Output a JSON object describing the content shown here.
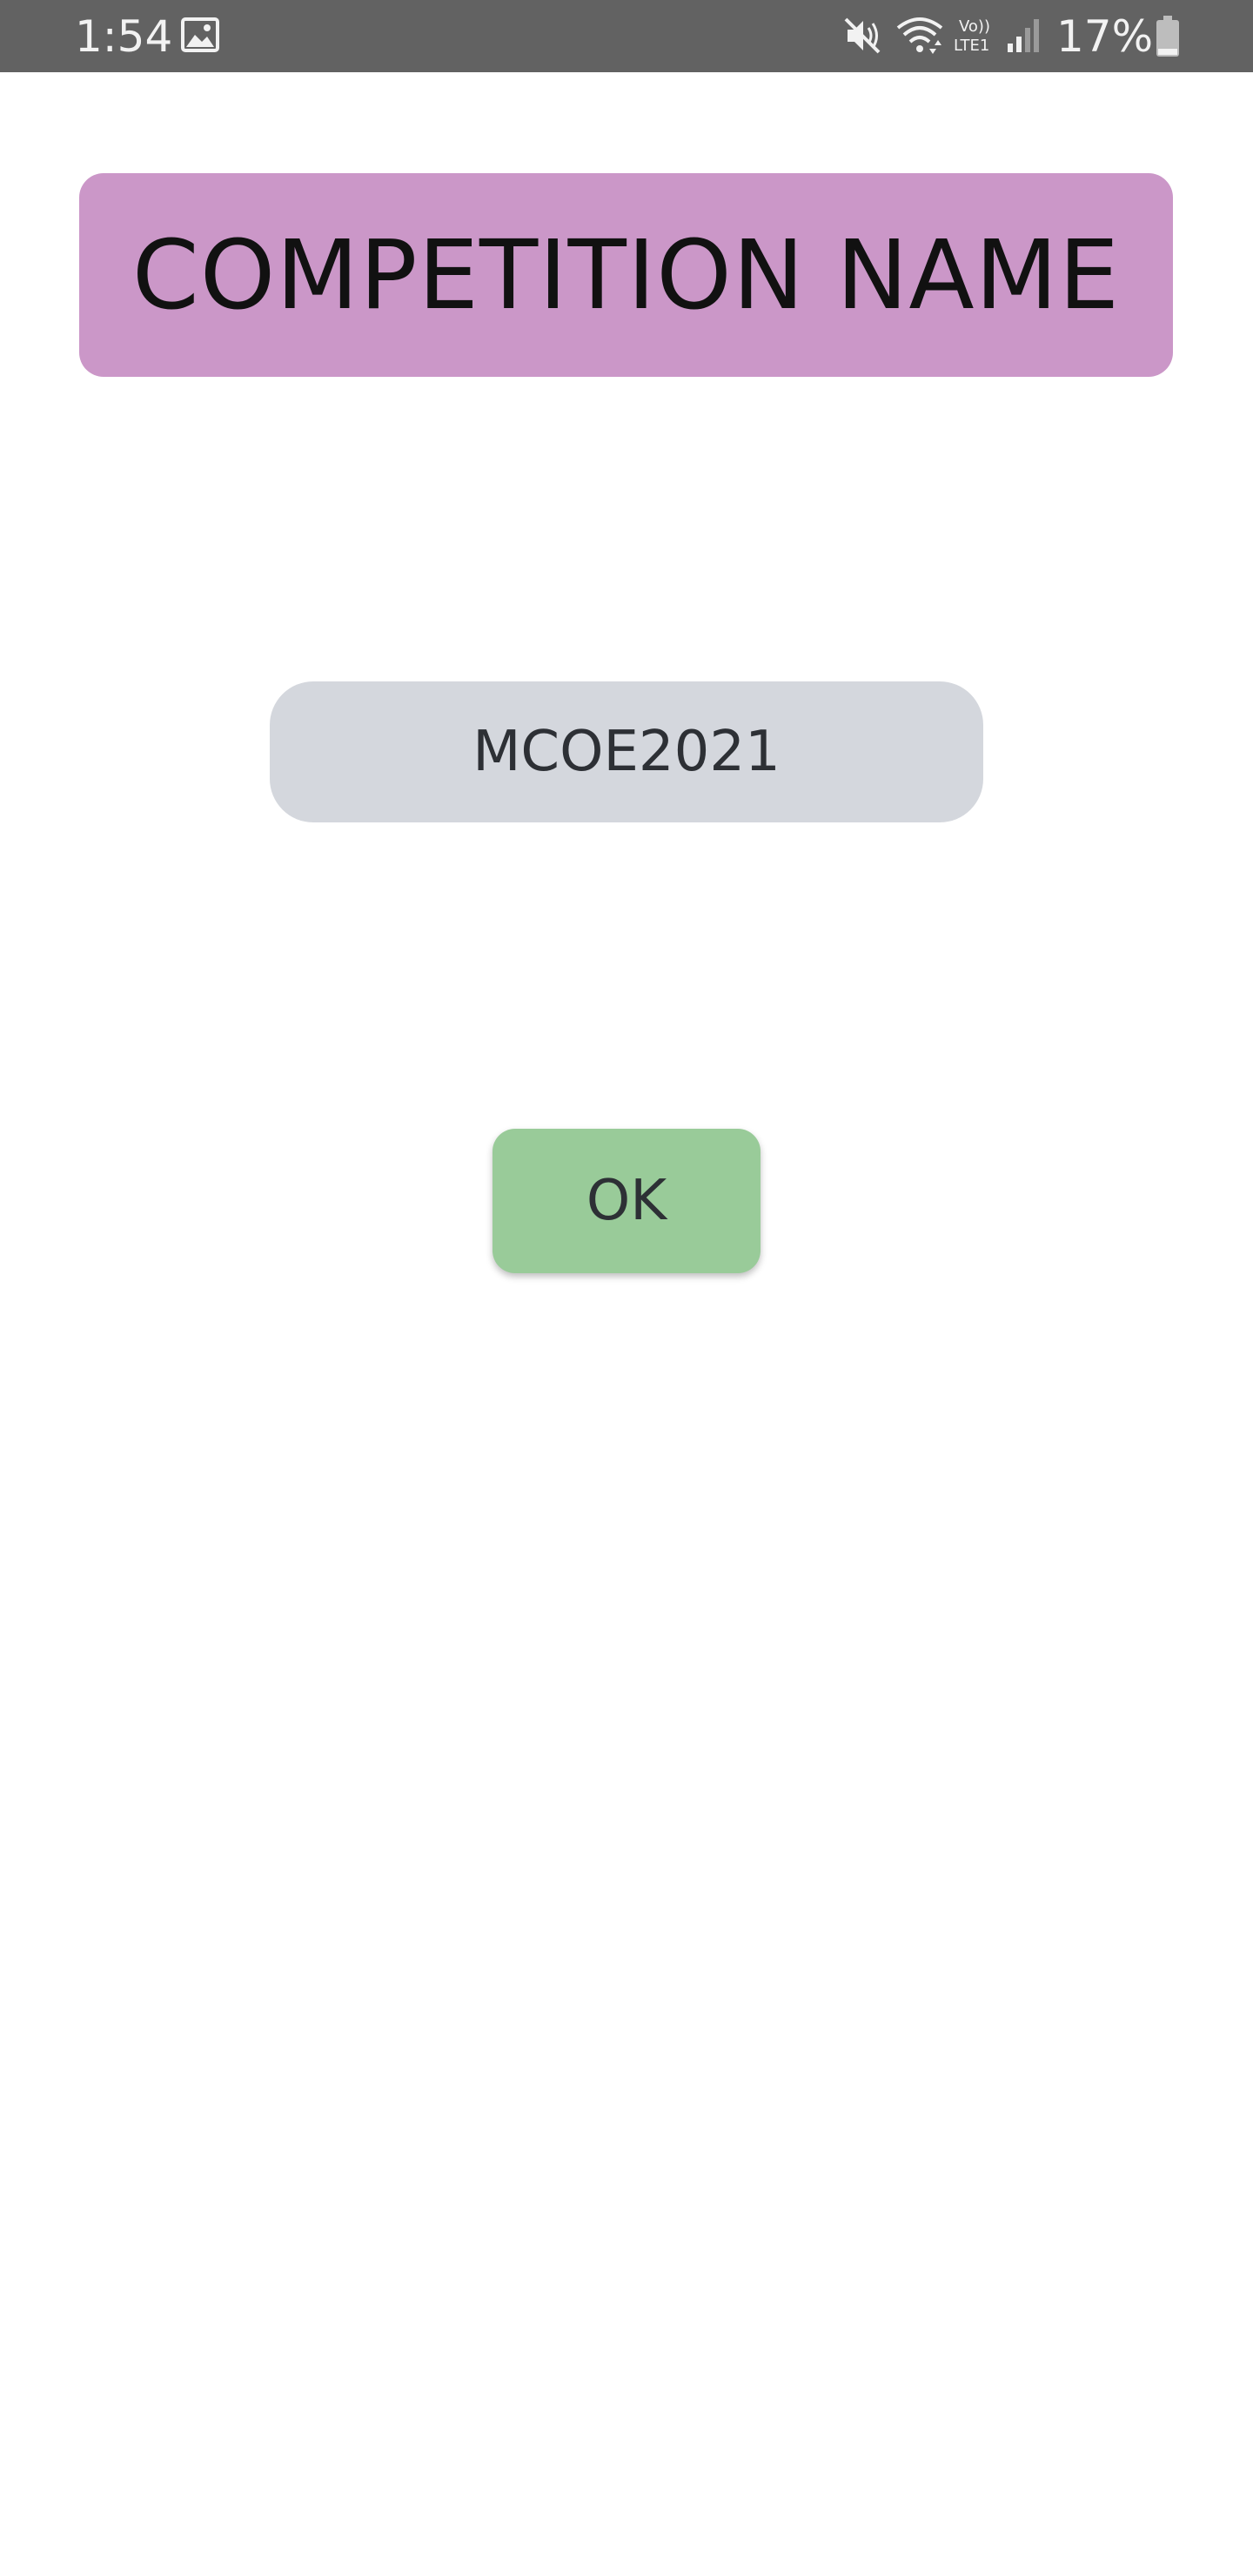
{
  "status_bar": {
    "time": "1:54",
    "battery_percent": "17%",
    "icons": [
      "gallery-icon",
      "mute-icon",
      "wifi-icon",
      "volte-icon",
      "signal-icon",
      "battery-icon"
    ],
    "background_color": "#626262"
  },
  "title_banner": {
    "label": "COMPETITION NAME",
    "background_color": "#cb97c8"
  },
  "competition_field": {
    "value": "MCOE2021",
    "background_color": "#d4d7dd"
  },
  "ok_button": {
    "label": "OK",
    "background_color": "#99cb99"
  }
}
